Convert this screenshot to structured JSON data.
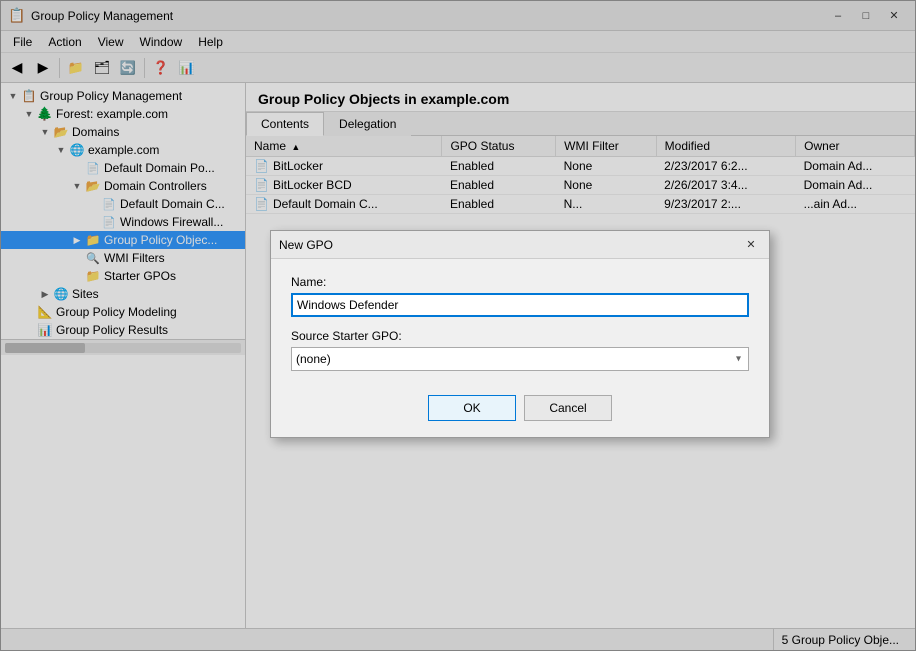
{
  "window": {
    "title": "Group Policy Management",
    "icon": "📋"
  },
  "menu": {
    "items": [
      "File",
      "Action",
      "View",
      "Window",
      "Help"
    ]
  },
  "toolbar": {
    "buttons": [
      "◀",
      "▶",
      "📁",
      "🗂",
      "🔄",
      "?",
      "📊"
    ]
  },
  "tree": {
    "root_label": "Group Policy Management",
    "items": [
      {
        "id": "forest",
        "label": "Forest: example.com",
        "level": 1,
        "expanded": true
      },
      {
        "id": "domains",
        "label": "Domains",
        "level": 2,
        "expanded": true
      },
      {
        "id": "example-com",
        "label": "example.com",
        "level": 3,
        "expanded": true
      },
      {
        "id": "default-domain-po",
        "label": "Default Domain Po...",
        "level": 4,
        "expanded": false
      },
      {
        "id": "domain-controllers",
        "label": "Domain Controllers",
        "level": 4,
        "expanded": true
      },
      {
        "id": "default-domain-c",
        "label": "Default Domain C...",
        "level": 5
      },
      {
        "id": "windows-firewall",
        "label": "Windows Firewall...",
        "level": 5
      },
      {
        "id": "group-policy-obj",
        "label": "Group Policy Objec...",
        "level": 4,
        "selected": true
      },
      {
        "id": "wmi-filters",
        "label": "WMI Filters",
        "level": 4
      },
      {
        "id": "starter-gpos",
        "label": "Starter GPOs",
        "level": 4
      },
      {
        "id": "sites",
        "label": "Sites",
        "level": 2
      },
      {
        "id": "gp-modeling",
        "label": "Group Policy Modeling",
        "level": 1
      },
      {
        "id": "gp-results",
        "label": "Group Policy Results",
        "level": 1
      }
    ]
  },
  "right_panel": {
    "title": "Group Policy Objects in example.com",
    "tabs": [
      "Contents",
      "Delegation"
    ],
    "active_tab": "Contents",
    "table": {
      "columns": [
        "Name",
        "GPO Status",
        "WMI Filter",
        "Modified",
        "Owner"
      ],
      "rows": [
        {
          "name": "BitLocker",
          "gpo_status": "Enabled",
          "wmi_filter": "None",
          "modified": "2/23/2017 6:2...",
          "owner": "Domain Ad..."
        },
        {
          "name": "BitLocker BCD",
          "gpo_status": "Enabled",
          "wmi_filter": "None",
          "modified": "2/26/2017 3:4...",
          "owner": "Domain Ad..."
        },
        {
          "name": "Default Domain C...",
          "gpo_status": "Enabled",
          "wmi_filter": "N...",
          "modified": "9/23/2017 2:...",
          "owner": "...ain Ad..."
        }
      ]
    }
  },
  "dialog": {
    "title": "New GPO",
    "name_label": "Name:",
    "name_value": "Windows Defender",
    "source_label": "Source Starter GPO:",
    "source_value": "(none)",
    "source_options": [
      "(none)"
    ],
    "ok_label": "OK",
    "cancel_label": "Cancel"
  },
  "status_bar": {
    "text": "5 Group Policy Obje..."
  }
}
